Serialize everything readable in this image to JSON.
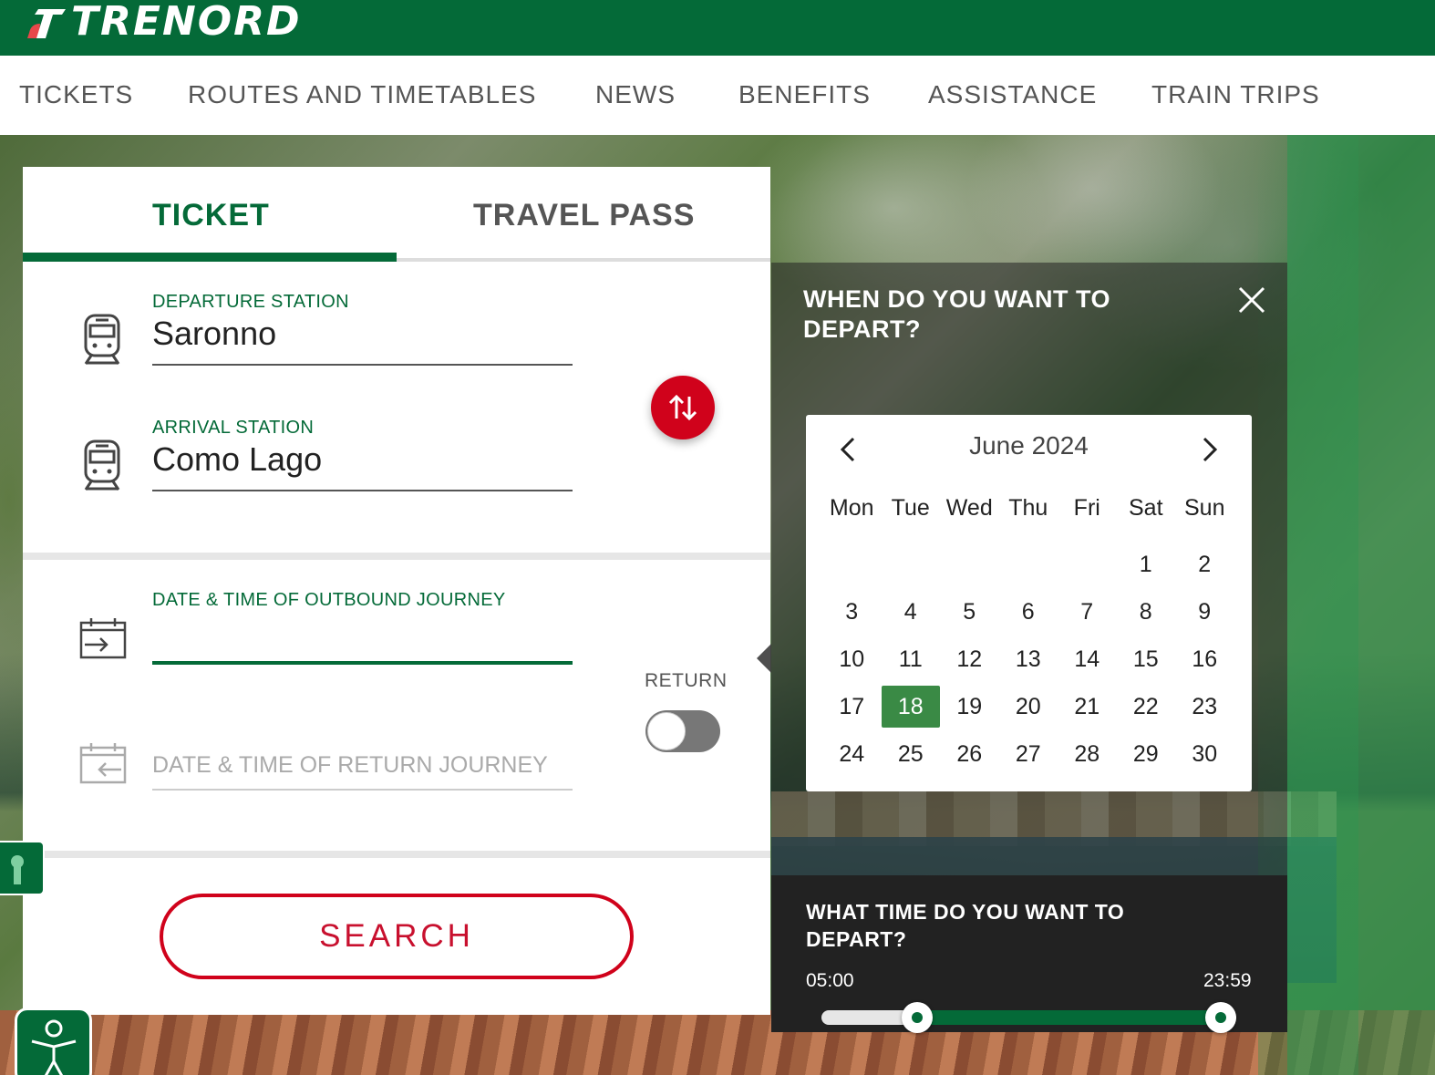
{
  "brand": {
    "logo_text": "TRENORD",
    "primary_color": "#046a38",
    "accent_color": "#d0021b"
  },
  "nav": {
    "items": [
      {
        "label": "TICKETS"
      },
      {
        "label": "ROUTES AND TIMETABLES"
      },
      {
        "label": "NEWS"
      },
      {
        "label": "BENEFITS"
      },
      {
        "label": "ASSISTANCE"
      },
      {
        "label": "TRAIN TRIPS"
      }
    ]
  },
  "booking": {
    "tabs": [
      {
        "label": "TICKET",
        "active": true
      },
      {
        "label": "TRAVEL PASS",
        "active": false
      }
    ],
    "departure": {
      "label": "DEPARTURE STATION",
      "value": "Saronno",
      "icon": "train-icon"
    },
    "arrival": {
      "label": "ARRIVAL STATION",
      "value": "Como Lago",
      "icon": "train-icon"
    },
    "swap_icon": "swap-arrows-icon",
    "outbound": {
      "label": "DATE & TIME OF OUTBOUND JOURNEY",
      "value": "",
      "icon": "calendar-outbound-icon"
    },
    "return_toggle": {
      "label": "RETURN",
      "on": false
    },
    "return_date": {
      "placeholder": "DATE & TIME OF RETURN JOURNEY",
      "icon": "calendar-return-icon"
    },
    "search_label": "SEARCH"
  },
  "date_picker": {
    "title": "WHEN DO YOU WANT TO DEPART?",
    "close_icon": "close-icon",
    "month_label": "June 2024",
    "weekdays": [
      "Mon",
      "Tue",
      "Wed",
      "Thu",
      "Fri",
      "Sat",
      "Sun"
    ],
    "weeks": [
      [
        "",
        "",
        "",
        "",
        "",
        "1",
        "2"
      ],
      [
        "3",
        "4",
        "5",
        "6",
        "7",
        "8",
        "9"
      ],
      [
        "10",
        "11",
        "12",
        "13",
        "14",
        "15",
        "16"
      ],
      [
        "17",
        "18",
        "19",
        "20",
        "21",
        "22",
        "23"
      ],
      [
        "24",
        "25",
        "26",
        "27",
        "28",
        "29",
        "30"
      ]
    ],
    "selected_day": "18"
  },
  "time_picker": {
    "title": "WHAT TIME DO YOU WANT TO DEPART?",
    "min_label": "05:00",
    "max_label": "23:59",
    "range_start_fraction": 0.21,
    "range_end_fraction": 1.0
  },
  "side_tab_icon": "keyhole-icon",
  "accessibility_icon": "accessibility-icon"
}
